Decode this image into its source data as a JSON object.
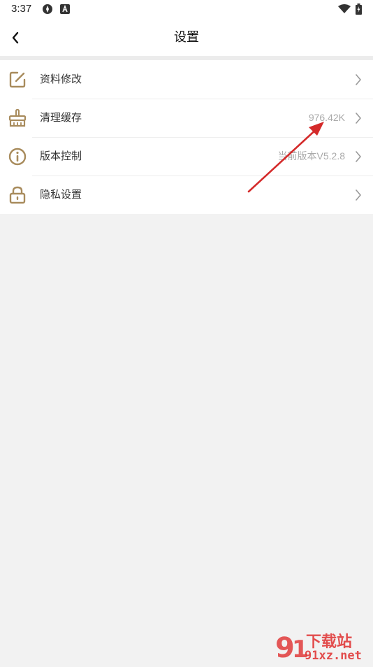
{
  "status_bar": {
    "time": "3:37"
  },
  "header": {
    "title": "设置"
  },
  "settings": {
    "items": [
      {
        "label": "资料修改",
        "value": "",
        "icon": "edit-icon"
      },
      {
        "label": "清理缓存",
        "value": "976.42K",
        "icon": "brush-icon"
      },
      {
        "label": "版本控制",
        "value": "当前版本V5.2.8",
        "icon": "info-icon"
      },
      {
        "label": "隐私设置",
        "value": "",
        "icon": "lock-icon"
      }
    ]
  },
  "watermark": {
    "brand": "下载站",
    "domain": "91xz.net"
  },
  "colors": {
    "accent_icon": "#a88b5c",
    "annotation": "#d42a2a",
    "watermark": "#e03030"
  }
}
